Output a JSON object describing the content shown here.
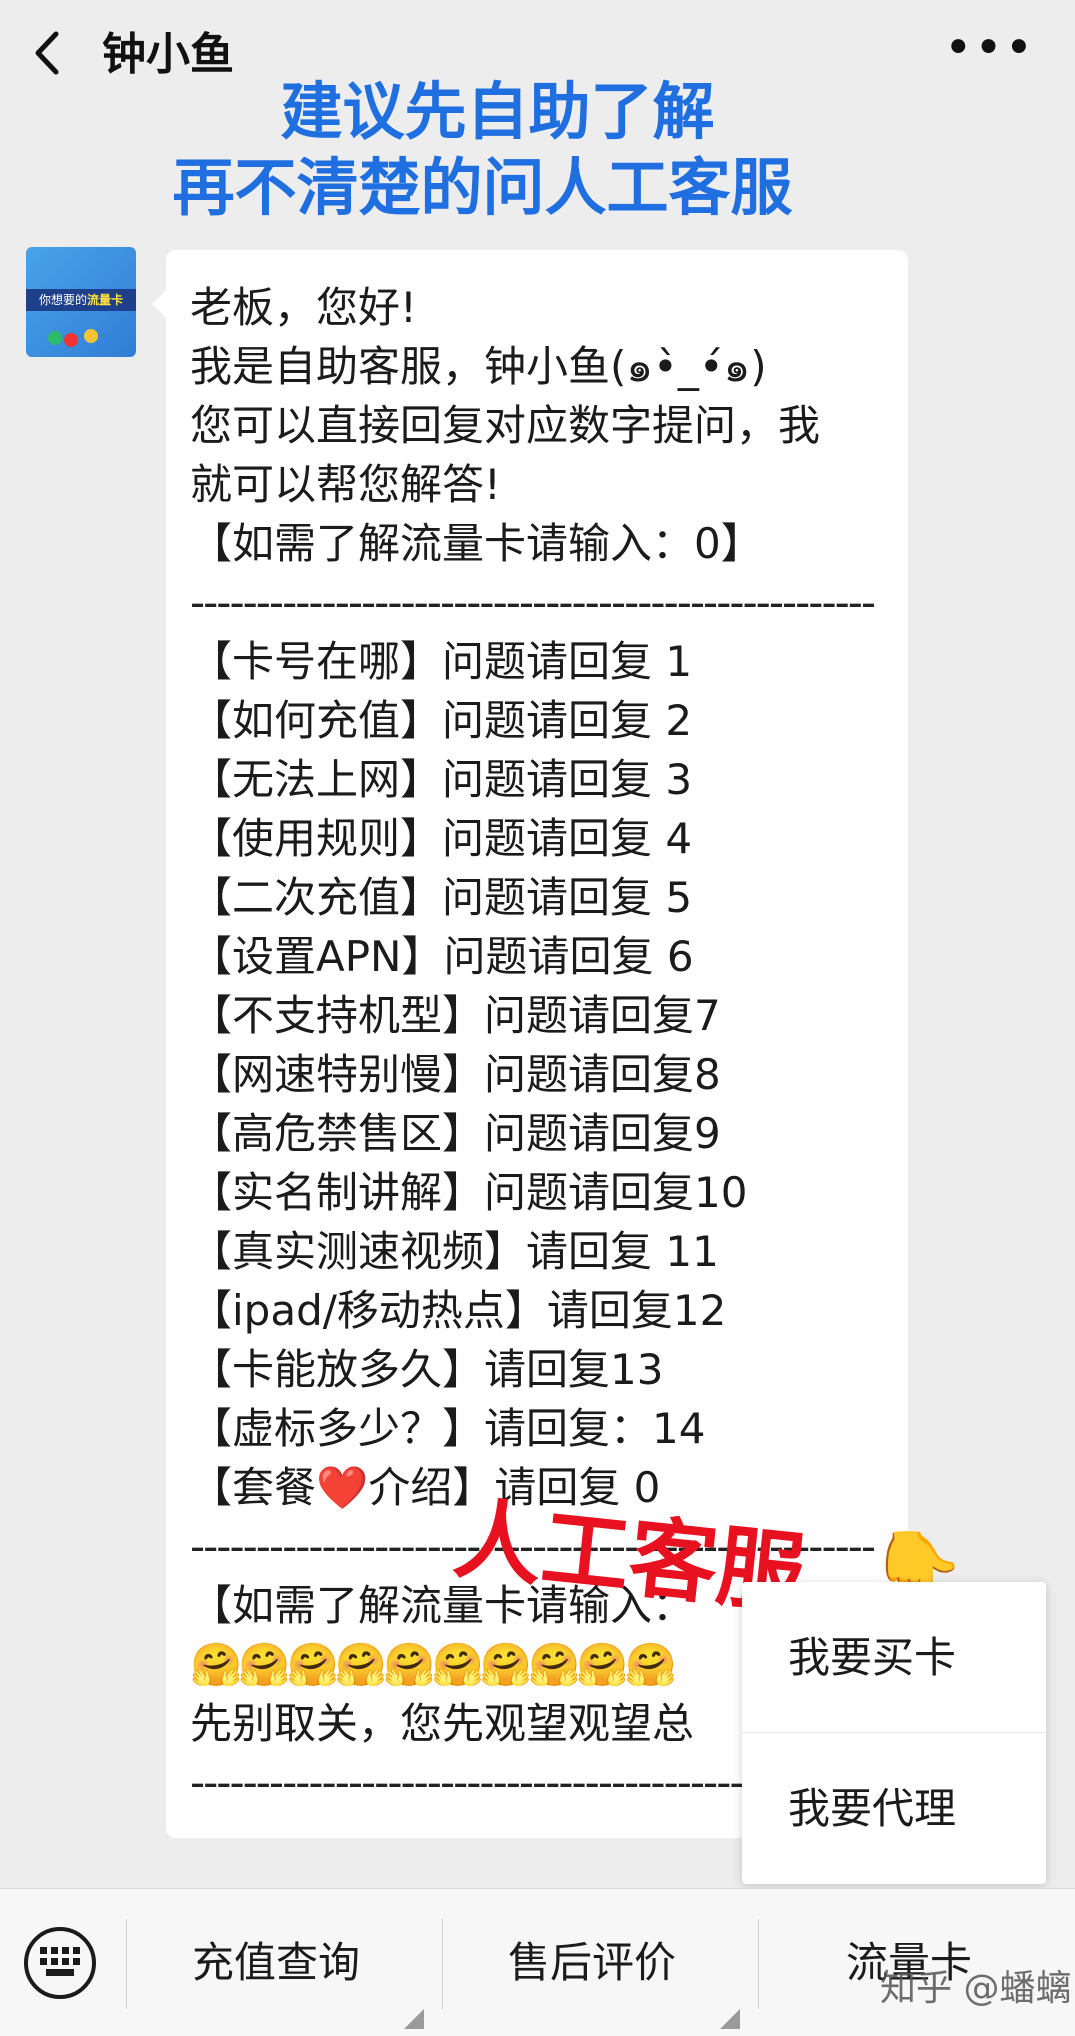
{
  "header": {
    "title": "钟小鱼",
    "more": "•••"
  },
  "caption": {
    "line1": "建议先自助了解",
    "line2": "再不清楚的问人工客服"
  },
  "avatar": {
    "text_a": "你想要的",
    "text_b": "流量卡"
  },
  "message": {
    "greeting": "老板，您好!",
    "intro": "我是自助客服，钟小鱼(๑•̀_•́๑)",
    "instruction_1": "您可以直接回复对应数字提问，我",
    "instruction_2": "就可以帮您解答!",
    "hint_top": "【如需了解流量卡请输入：0】",
    "divider": "----------------------------------------------------",
    "options": [
      "【卡号在哪】问题请回复 1",
      "【如何充值】问题请回复 2",
      "【无法上网】问题请回复 3",
      "【使用规则】问题请回复 4",
      "【二次充值】问题请回复 5",
      "【设置APN】问题请回复 6",
      "【不支持机型】问题请回复7",
      "【网速特别慢】问题请回复8",
      "【高危禁售区】问题请回复9",
      "【实名制讲解】问题请回复10",
      "【真实测速视频】请回复 11",
      "【ipad/移动热点】请回复12",
      "【卡能放多久】请回复13",
      "【虚标多少？】请回复：14"
    ],
    "package_a": "【套餐",
    "package_heart": "❤️",
    "package_b": "介绍】请回复 0",
    "hint_bottom": "【如需了解流量卡请输入：",
    "emojis": "🤗🤗🤗🤗🤗🤗🤗🤗🤗🤗",
    "footer": "先别取关，您先观望观望总"
  },
  "annotation": {
    "text": "人工客服",
    "hand": "👇"
  },
  "popup": {
    "items": [
      "我要买卡",
      "我要代理"
    ]
  },
  "bottom_menu": {
    "keyboard_icon": "keyboard-icon",
    "tabs": [
      "充值查询",
      "售后评价",
      "流量卡"
    ]
  },
  "watermark": "知乎 @蟠螭"
}
